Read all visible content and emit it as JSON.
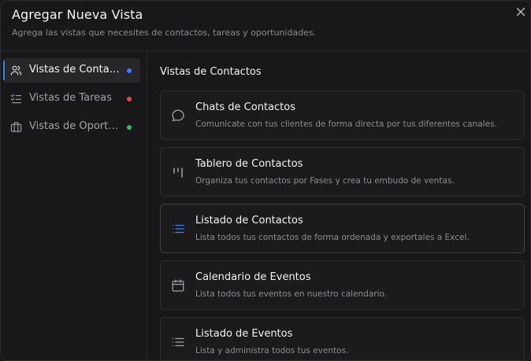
{
  "header": {
    "title": "Agregar Nueva Vista",
    "subtitle": "Agrega las vistas que necesites de contactos, tareas y oportunidades."
  },
  "sidebar": {
    "items": [
      {
        "label": "Vistas de Contactos",
        "icon": "users-icon",
        "dot_color": "#3b82f6",
        "active": true
      },
      {
        "label": "Vistas de Tareas",
        "icon": "checklist-icon",
        "dot_color": "#ef4444",
        "active": false
      },
      {
        "label": "Vistas de Oportunidades",
        "icon": "briefcase-icon",
        "dot_color": "#22c55e",
        "active": false
      }
    ]
  },
  "main": {
    "section_title": "Vistas de Contactos",
    "cards": [
      {
        "title": "Chats de Contactos",
        "description": "Comunicate con tus clientes de forma directa por tus diferentes canales.",
        "icon": "chat-bubble-icon",
        "selected": false
      },
      {
        "title": "Tablero de Contactos",
        "description": "Organiza tus contactos por Fases y crea tu embudo de ventas.",
        "icon": "kanban-icon",
        "selected": false
      },
      {
        "title": "Listado de Contactos",
        "description": "Lista todos tus contactos de forma ordenada y exportales a Excel.",
        "icon": "list-icon",
        "selected": true
      },
      {
        "title": "Calendario de Eventos",
        "description": "Lista todos tus eventos en nuestro calendario.",
        "icon": "calendar-icon",
        "selected": false
      },
      {
        "title": "Listado de Eventos",
        "description": "Lista y administra todos tus eventos.",
        "icon": "list-icon",
        "selected": false
      }
    ]
  },
  "colors": {
    "accent": "#3b82f6",
    "background": "#18181b",
    "selected_border": "#1e4a6f"
  }
}
